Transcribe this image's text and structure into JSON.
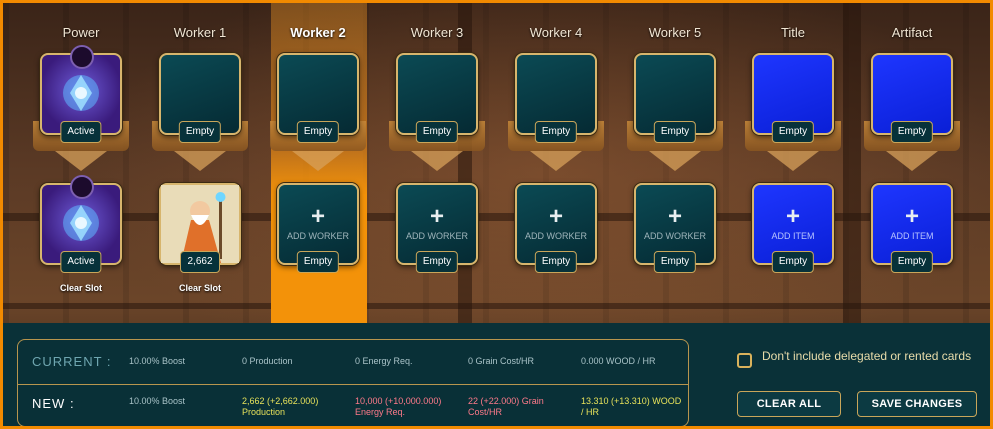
{
  "columns": [
    {
      "header": "Power",
      "top": {
        "kind": "purple",
        "badge": "Active"
      },
      "bottom": {
        "kind": "purple",
        "badge": "Active",
        "clear": "Clear Slot"
      }
    },
    {
      "header": "Worker 1",
      "top": {
        "kind": "teal",
        "badge": "Empty"
      },
      "bottom": {
        "kind": "wizard",
        "badge": "2,662",
        "clear": "Clear Slot"
      }
    },
    {
      "header": "Worker 2",
      "top": {
        "kind": "teal",
        "badge": "Empty"
      },
      "bottom": {
        "kind": "teal",
        "badge": "Empty",
        "add": "ADD WORKER"
      }
    },
    {
      "header": "Worker 3",
      "top": {
        "kind": "teal",
        "badge": "Empty"
      },
      "bottom": {
        "kind": "teal",
        "badge": "Empty",
        "add": "ADD WORKER"
      }
    },
    {
      "header": "Worker 4",
      "top": {
        "kind": "teal",
        "badge": "Empty"
      },
      "bottom": {
        "kind": "teal",
        "badge": "Empty",
        "add": "ADD WORKER"
      }
    },
    {
      "header": "Worker 5",
      "top": {
        "kind": "teal",
        "badge": "Empty"
      },
      "bottom": {
        "kind": "teal",
        "badge": "Empty",
        "add": "ADD WORKER"
      }
    },
    {
      "header": "Title",
      "top": {
        "kind": "blue",
        "badge": "Empty"
      },
      "bottom": {
        "kind": "blue",
        "badge": "Empty",
        "add": "ADD ITEM"
      }
    },
    {
      "header": "Artifact",
      "top": {
        "kind": "blue",
        "badge": "Empty"
      },
      "bottom": {
        "kind": "blue",
        "badge": "Empty",
        "add": "ADD ITEM"
      }
    }
  ],
  "selected_column": 2,
  "plus_glyph": "+",
  "stats": {
    "current": {
      "label": "CURRENT :",
      "cells": [
        "10.00% Boost",
        "0 Production",
        "0 Energy Req.",
        "0 Grain Cost/HR",
        "0.000 WOOD / HR"
      ]
    },
    "new": {
      "label": "NEW :",
      "cells": [
        "10.00% Boost",
        "2,662 (+2,662.000) Production",
        "10,000 (+10,000.000) Energy Req.",
        "22 (+22.000) Grain Cost/HR",
        "13.310 (+13.310) WOOD / HR"
      ]
    }
  },
  "options": {
    "exclude_delegated_label": "Don't include delegated or rented cards",
    "exclude_delegated_checked": false
  },
  "buttons": {
    "clear_all": "CLEAR ALL",
    "save_changes": "SAVE CHANGES"
  },
  "colors": {
    "accent_orange": "#f39209",
    "gold_border": "#d7b56d",
    "teal_slot": "#0b4a54",
    "blue_slot": "#1e36ff",
    "new_production": "#e8e25a",
    "new_cost": "#ff7a8a"
  }
}
